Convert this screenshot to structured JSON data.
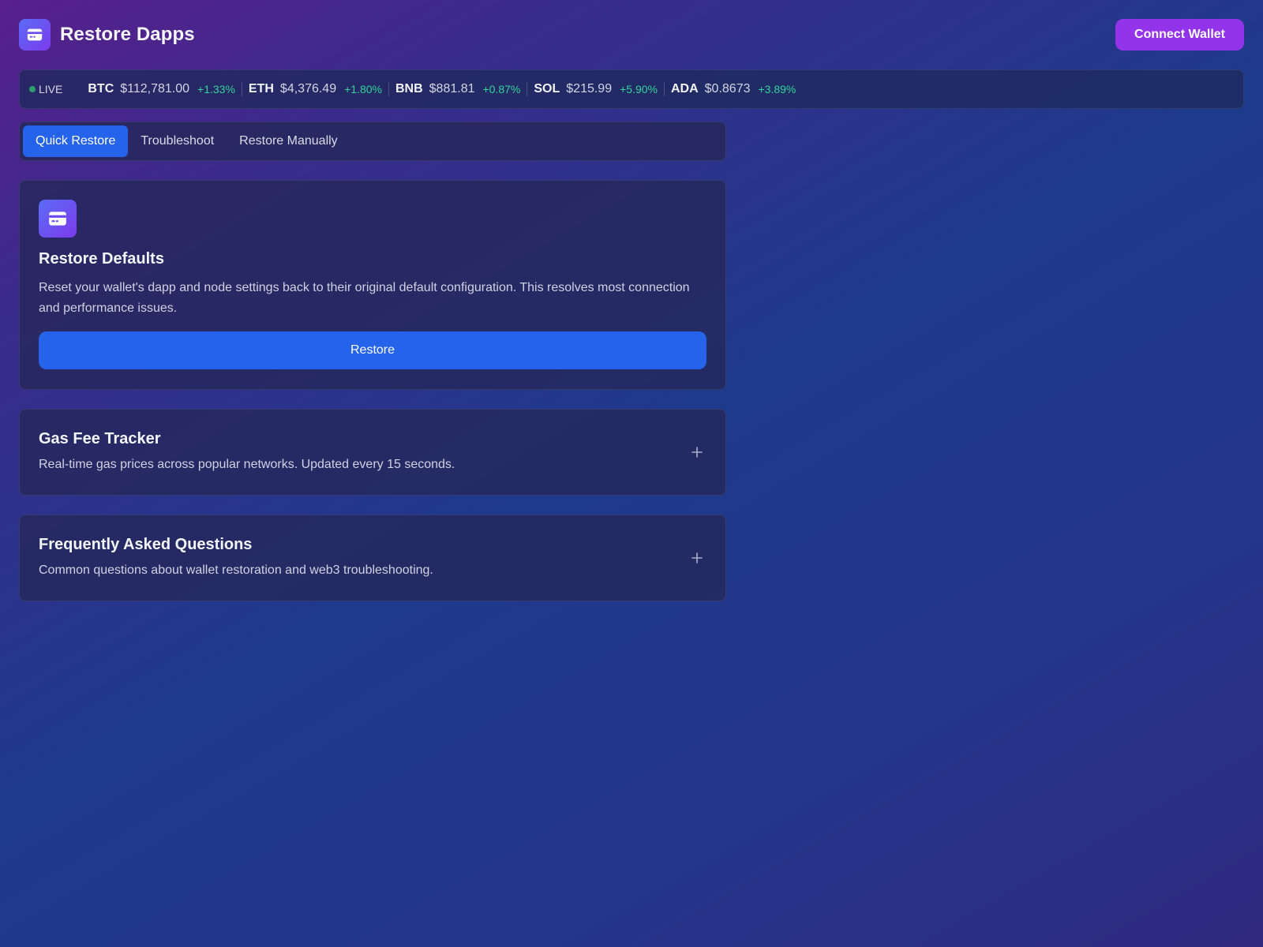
{
  "header": {
    "logo_icon": "credit-card-icon",
    "title": "Restore Dapps",
    "connect_label": "Connect Wallet"
  },
  "ticker": {
    "live_label": "LIVE",
    "coins": [
      {
        "symbol": "BTC",
        "price": "$112,781.00",
        "change": "+1.33%"
      },
      {
        "symbol": "ETH",
        "price": "$4,376.49",
        "change": "+1.80%"
      },
      {
        "symbol": "BNB",
        "price": "$881.81",
        "change": "+0.87%"
      },
      {
        "symbol": "SOL",
        "price": "$215.99",
        "change": "+5.90%"
      },
      {
        "symbol": "ADA",
        "price": "$0.8673",
        "change": "+3.89%"
      }
    ]
  },
  "tabs": [
    {
      "label": "Quick Restore",
      "active": true
    },
    {
      "label": "Troubleshoot",
      "active": false
    },
    {
      "label": "Restore Manually",
      "active": false
    }
  ],
  "restore_card": {
    "icon": "credit-card-icon",
    "title": "Restore Defaults",
    "description": "Reset your wallet's dapp and node settings back to their original default configuration. This resolves most connection and performance issues.",
    "button_label": "Restore"
  },
  "gas_card": {
    "title": "Gas Fee Tracker",
    "description": "Real-time gas prices across popular networks. Updated every 15 seconds.",
    "expand_icon": "plus-icon"
  },
  "faq_card": {
    "title": "Frequently Asked Questions",
    "description": "Common questions about wallet restoration and web3 troubleshooting.",
    "expand_icon": "plus-icon"
  },
  "colors": {
    "accent_blue": "#2563eb",
    "accent_purple": "#9333ea",
    "positive_green": "#34d399",
    "live_dot": "#2f9e6a"
  }
}
